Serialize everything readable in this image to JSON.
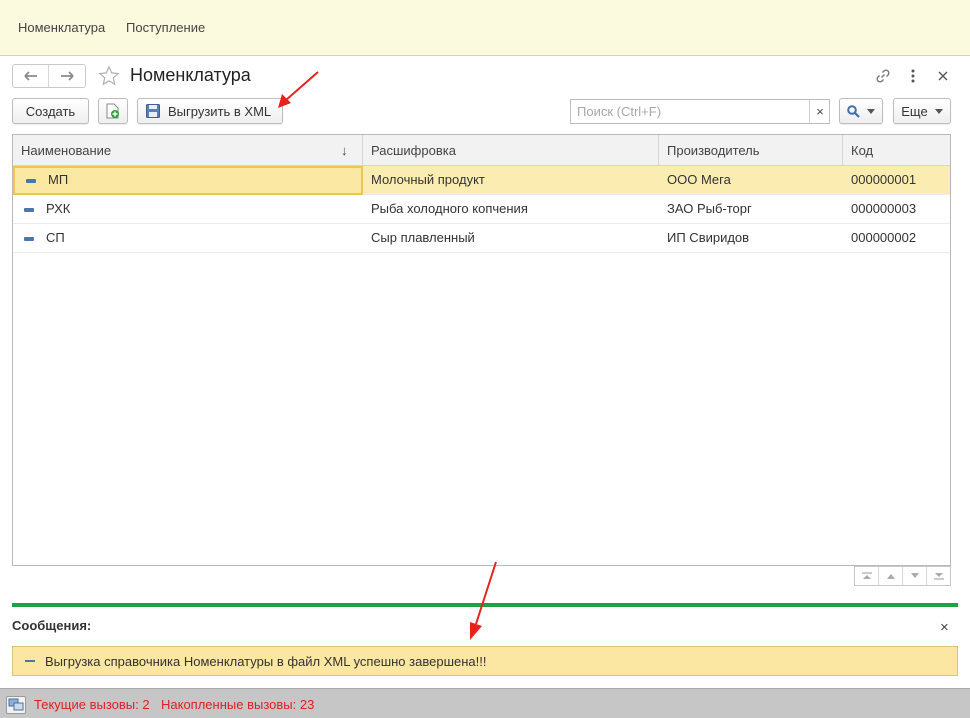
{
  "topnav": {
    "items": [
      {
        "label": "Номенклатура"
      },
      {
        "label": "Поступление"
      }
    ]
  },
  "form": {
    "title": "Номенклатура"
  },
  "toolbar": {
    "create_label": "Создать",
    "export_label": "Выгрузить в XML",
    "search_placeholder": "Поиск (Ctrl+F)",
    "clear_label": "×",
    "more_label": "Еще"
  },
  "table": {
    "columns": [
      "Наименование",
      "Расшифровка",
      "Производитель",
      "Код"
    ],
    "sort_indicator": "↓",
    "rows": [
      {
        "name": "МП",
        "desc": "Молочный продукт",
        "maker": "ООО Мега",
        "code": "000000001"
      },
      {
        "name": "РХК",
        "desc": "Рыба холодного копчения",
        "maker": "ЗАО Рыб-торг",
        "code": "000000003"
      },
      {
        "name": "СП",
        "desc": "Сыр плавленный",
        "maker": "ИП Свиридов",
        "code": "000000002"
      }
    ]
  },
  "messages": {
    "title": "Сообщения:",
    "close_label": "×",
    "items": [
      {
        "text": "Выгрузка справочника Номенклатуры в файл XML успешно завершена!!!"
      }
    ]
  },
  "status": {
    "current_calls": "Текущие вызовы: 2",
    "accumulated_calls": "Накопленные вызовы: 23"
  },
  "colors": {
    "accent_green": "#1ea249",
    "selected_row": "#fbedb2",
    "status_text": "#e02020",
    "annotation_arrow": "#e8231e"
  }
}
